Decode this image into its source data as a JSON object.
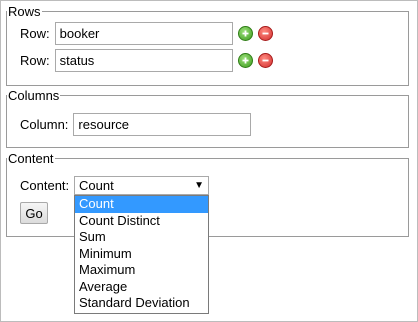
{
  "rows_section": {
    "legend": "Rows",
    "rows": [
      {
        "label": "Row:",
        "value": "booker"
      },
      {
        "label": "Row:",
        "value": "status"
      }
    ],
    "add_icon": "plus-circle-icon",
    "remove_icon": "minus-circle-icon"
  },
  "columns_section": {
    "legend": "Columns",
    "label": "Column:",
    "value": "resource"
  },
  "content_section": {
    "legend": "Content",
    "label": "Content:",
    "selected": "Count",
    "arrow": "▼",
    "go_label": "Go",
    "options": [
      "Count",
      "Count Distinct",
      "Sum",
      "Minimum",
      "Maximum",
      "Average",
      "Standard Deviation"
    ]
  },
  "colors": {
    "selection": "#3399ff",
    "add": "#3d9b1e",
    "remove": "#d32f2f"
  }
}
